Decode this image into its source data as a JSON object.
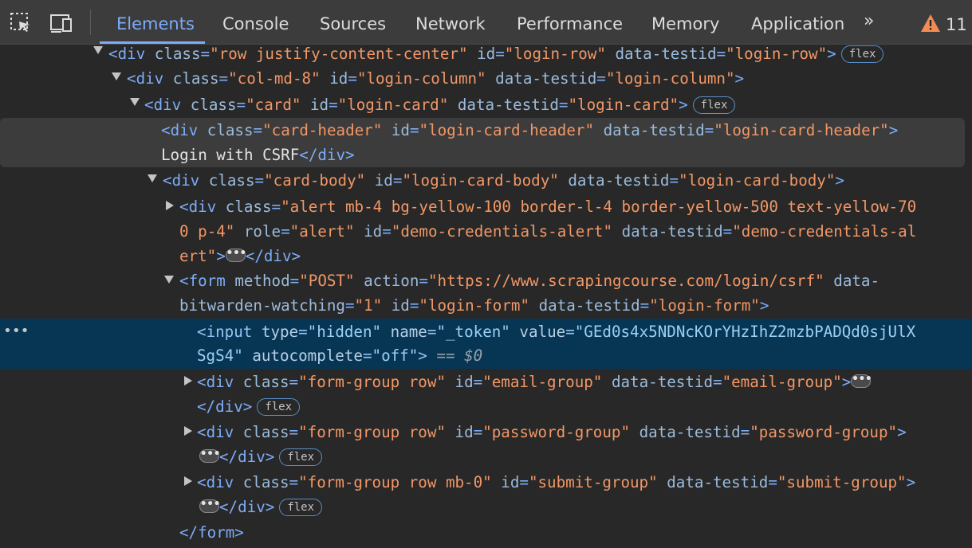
{
  "toolbar": {
    "tabs": [
      "Elements",
      "Console",
      "Sources",
      "Network",
      "Performance",
      "Memory",
      "Application"
    ],
    "more": "»",
    "warning_count": "11",
    "icons": [
      "inspect-element-icon",
      "device-toolbar-icon",
      "chevron-double-right-icon",
      "warning-icon"
    ]
  },
  "tree": {
    "row_line": {
      "tag": "div",
      "class_attr": "class",
      "class_val": "\"row justify-content-center\"",
      "id_attr": "id",
      "id_val": "\"login-row\"",
      "testid_attr": "data-testid",
      "testid_val": "\"login-row\"",
      "badge": "flex"
    },
    "column_line": {
      "tag": "div",
      "class_attr": "class",
      "class_val": "\"col-md-8\"",
      "id_attr": "id",
      "id_val": "\"login-column\"",
      "testid_attr": "data-testid",
      "testid_val": "\"login-column\""
    },
    "card_line": {
      "tag": "div",
      "class_attr": "class",
      "class_val": "\"card\"",
      "id_attr": "id",
      "id_val": "\"login-card\"",
      "testid_attr": "data-testid",
      "testid_val": "\"login-card\"",
      "badge": "flex"
    },
    "card_header_line": {
      "tag": "div",
      "class_attr": "class",
      "class_val": "\"card-header\"",
      "id_attr": "id",
      "id_val": "\"login-card-header\"",
      "testid_attr": "data-testid",
      "testid_val": "\"login-card-header\"",
      "text": "Login with CSRF",
      "close": "</div>"
    },
    "card_body_line": {
      "tag": "div",
      "class_attr": "class",
      "class_val": "\"card-body\"",
      "id_attr": "id",
      "id_val": "\"login-card-body\"",
      "testid_attr": "data-testid",
      "testid_val": "\"login-card-body\""
    },
    "alert_line": {
      "tag": "div",
      "class_attr": "class",
      "class_val_1": "\"alert mb-4 bg-yellow-100 border-l-4 border-yellow-500 text-yellow-70",
      "class_val_2": "0 p-4\"",
      "role_attr": "role",
      "role_val": "\"alert\"",
      "id_attr": "id",
      "id_val": "\"demo-credentials-alert\"",
      "testid_attr": "data-testid",
      "testid_val_1": "\"demo-credentials-al",
      "testid_val_2": "ert\"",
      "ellipsis": "•••",
      "close": "</div>"
    },
    "form_line": {
      "tag": "form",
      "method_attr": "method",
      "method_val": "\"POST\"",
      "action_attr": "action",
      "action_val": "\"https://www.scrapingcourse.com/login/csrf\"",
      "bw_attr_1": "data-",
      "bw_attr_2": "bitwarden-watching",
      "bw_val": "\"1\"",
      "id_attr": "id",
      "id_val": "\"login-form\"",
      "testid_attr": "data-testid",
      "testid_val": "\"login-form\""
    },
    "input_line": {
      "tag": "input",
      "type_attr": "type",
      "type_val": "\"hidden\"",
      "name_attr": "name",
      "name_val": "\"_token\"",
      "value_attr": "value",
      "value_val_1": "\"GEd0s4x5NDNcKOrYHzIhZ2mzbPADQd0sjUlX",
      "value_val_2": "SgS4\"",
      "autocomplete_attr": "autocomplete",
      "autocomplete_val": "\"off\"",
      "eq": "==",
      "ref": "$0",
      "row_menu": "•••"
    },
    "email_line": {
      "tag": "div",
      "class_attr": "class",
      "class_val": "\"form-group row\"",
      "id_attr": "id",
      "id_val": "\"email-group\"",
      "testid_attr": "data-testid",
      "testid_val": "\"email-group\"",
      "ellipsis": "•••",
      "close": "</div>",
      "badge": "flex"
    },
    "password_line": {
      "tag": "div",
      "class_attr": "class",
      "class_val": "\"form-group row\"",
      "id_attr": "id",
      "id_val": "\"password-group\"",
      "testid_attr": "data-testid",
      "testid_val": "\"password-group\"",
      "ellipsis": "•••",
      "close": "</div>",
      "badge": "flex"
    },
    "submit_line": {
      "tag": "div",
      "class_attr": "class",
      "class_val": "\"form-group row mb-0\"",
      "id_attr": "id",
      "id_val": "\"submit-group\"",
      "testid_attr": "data-testid",
      "testid_val": "\"submit-group\"",
      "ellipsis": "•••",
      "close": "</div>",
      "badge": "flex"
    },
    "form_close": "</form>"
  },
  "colors": {
    "background": "#282828",
    "toolbar": "#3c3c3c",
    "tag": "#7cacf8",
    "attr_name": "#9bbbdc",
    "attr_value": "#f29766",
    "selected_row": "#073655",
    "hover_row": "#3c3c3c",
    "warning": "#f28b54"
  }
}
